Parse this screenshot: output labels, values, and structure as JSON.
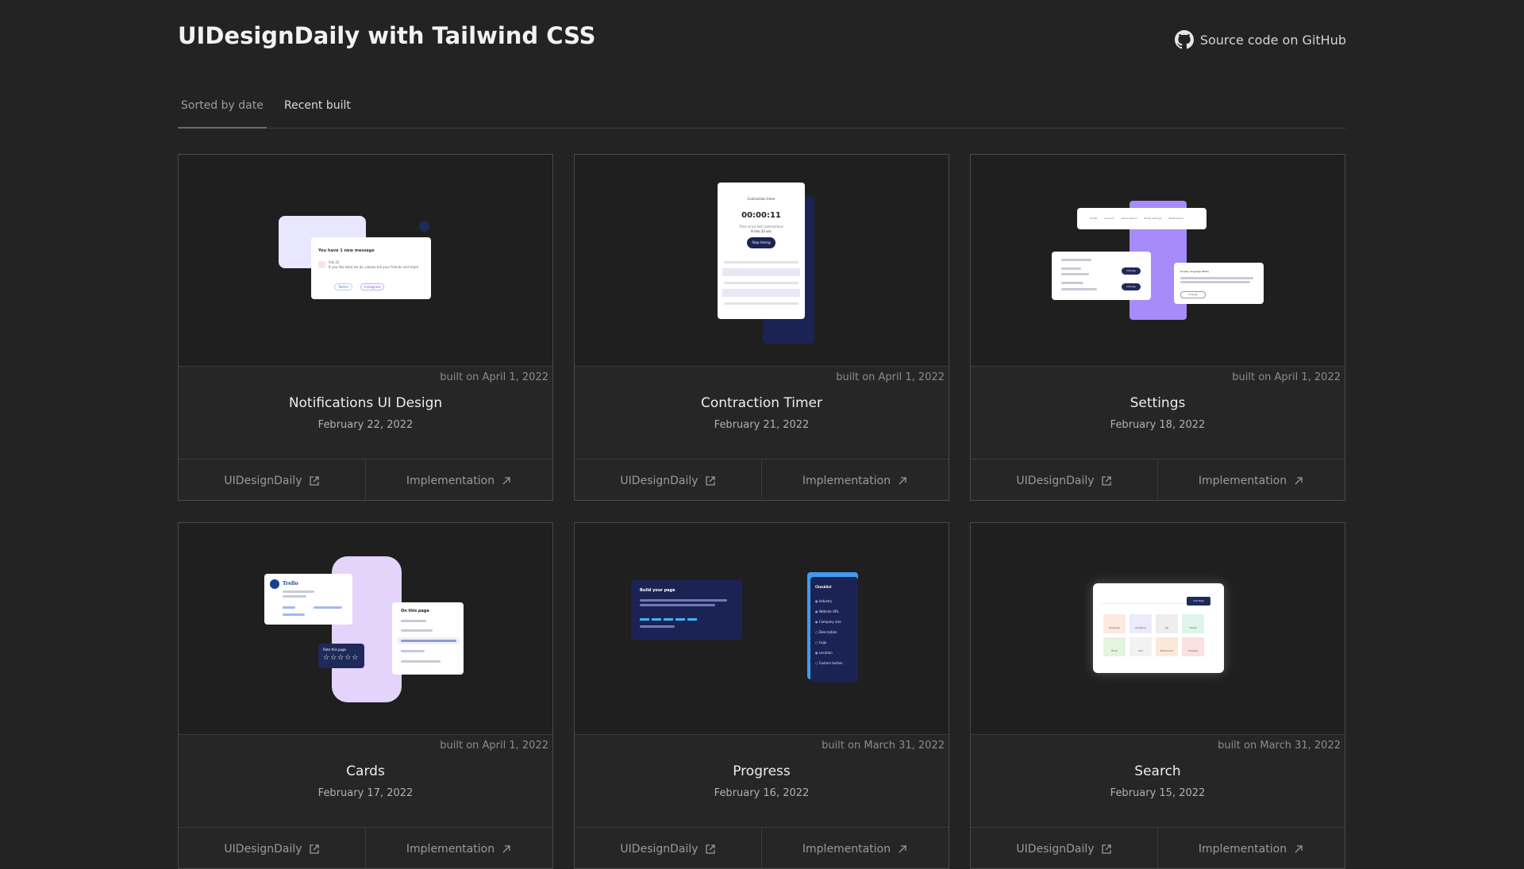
{
  "header": {
    "title": "UIDesignDaily with Tailwind CSS",
    "github_link": "Source code on GitHub",
    "github_icon": "github-icon"
  },
  "tabs": [
    {
      "label": "Sorted by date",
      "active": true
    },
    {
      "label": "Recent built",
      "active": false
    }
  ],
  "link_labels": {
    "source": "UIDesignDaily",
    "implementation": "Implementation"
  },
  "cards": [
    {
      "title": "Notifications UI Design",
      "date": "February 22, 2022",
      "built": "built on April 1, 2022",
      "preview": {
        "heading": "You have 1 new message",
        "sub": "Feb 22",
        "body": "If you like what we do, please tell your friends and share",
        "chips": [
          "Twitter",
          "Instagram"
        ]
      }
    },
    {
      "title": "Contraction Timer",
      "date": "February 21, 2022",
      "built": "built on April 1, 2022",
      "preview": {
        "heading": "Contraction timer",
        "time": "00:00:11",
        "sub": "Time since last contractions",
        "sub2": "9 min 33 sec",
        "button": "Stop timing"
      }
    },
    {
      "title": "Settings",
      "date": "February 18, 2022",
      "built": "built on April 1, 2022",
      "preview": {
        "tabs": [
          "Profile",
          "Account",
          "Subscriptions",
          "Email Settings",
          "Notifications"
        ],
        "panel_heading": "Display language (Beta)",
        "buttons": [
          "Change",
          "Change",
          "Change"
        ]
      }
    },
    {
      "title": "Cards",
      "date": "February 17, 2022",
      "built": "built on April 1, 2022",
      "preview": {
        "brand": "Trello",
        "rate": "Rate this page",
        "toc": "On this page",
        "stars": "☆☆☆☆☆"
      }
    },
    {
      "title": "Progress",
      "date": "February 16, 2022",
      "built": "built on March 31, 2022",
      "preview": {
        "heading": "Build your page",
        "checklist": "Checklist",
        "items": [
          "Industry",
          "Website URL",
          "Company size",
          "Description",
          "Logo",
          "Location",
          "Custom button"
        ]
      }
    },
    {
      "title": "Search",
      "date": "February 15, 2022",
      "built": "built on March 31, 2022",
      "preview": {
        "button": "Get Help",
        "tiles": [
          "Bookings",
          "Shopping",
          "Job",
          "Travel",
          "Book",
          "Sell",
          "Electronics",
          "Hobbies"
        ]
      }
    }
  ],
  "colors": {
    "background": "#232323",
    "card_border": "#4a4a4a",
    "accent_purple": "#a78bfa",
    "navy": "#1e2a5a"
  }
}
